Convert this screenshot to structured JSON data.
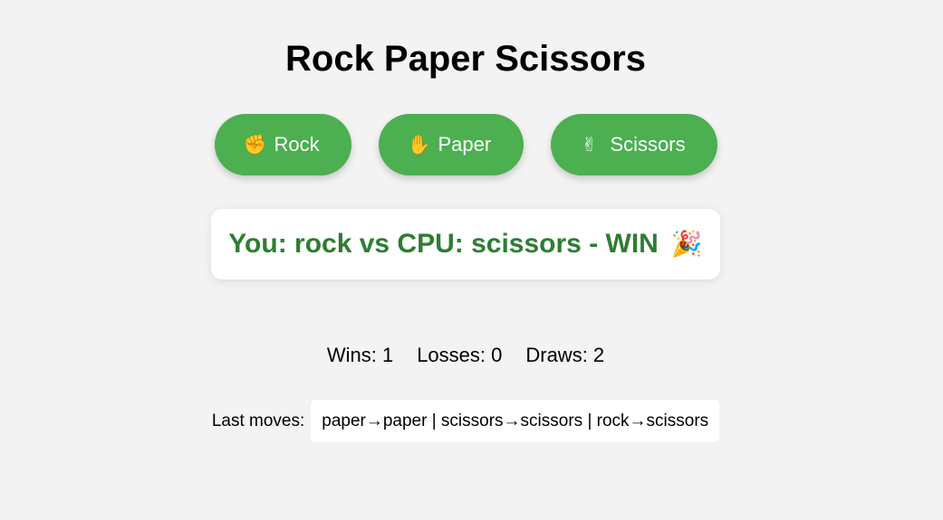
{
  "app": {
    "title": "Rock Paper Scissors"
  },
  "choices": [
    {
      "icon": "raised-fist-icon",
      "glyph": "✊",
      "label": "Rock"
    },
    {
      "icon": "raised-hand-icon",
      "glyph": "✋",
      "label": "Paper"
    },
    {
      "icon": "victory-hand-icon",
      "glyph": "✌",
      "label": "Scissors"
    }
  ],
  "result": {
    "text": "You: rock vs CPU: scissors - WIN",
    "icon": "party-popper-icon",
    "glyph": "🎉",
    "color": "#2e7d32"
  },
  "score": {
    "wins": "Wins: 1",
    "losses": "Losses: 0",
    "draws": "Draws: 2"
  },
  "history": {
    "label": "Last moves:",
    "moves": "paper→paper | scissors→scissors | rock→scissors"
  },
  "colors": {
    "background": "#f3f3f3",
    "button": "#4caf50",
    "win_text": "#2e7d32"
  }
}
